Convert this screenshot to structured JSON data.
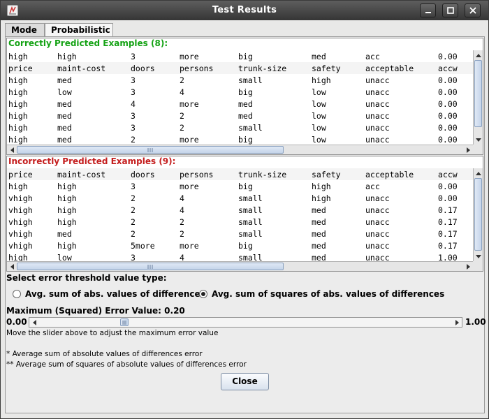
{
  "window": {
    "title": "Test Results"
  },
  "tabs": [
    {
      "label": "Mode"
    },
    {
      "label": "Probabilistic"
    }
  ],
  "columns": [
    "price",
    "maint-cost",
    "doors",
    "persons",
    "trunk-size",
    "safety",
    "acceptable",
    "accw"
  ],
  "correct": {
    "caption": "Correctly Predicted Examples (8):",
    "rows": [
      [
        "high",
        "high",
        "3",
        "more",
        "big",
        "med",
        "acc",
        "0.00"
      ],
      [
        "high",
        "med",
        "3",
        "2",
        "small",
        "high",
        "unacc",
        "0.00"
      ],
      [
        "high",
        "low",
        "3",
        "4",
        "big",
        "low",
        "unacc",
        "0.00"
      ],
      [
        "high",
        "med",
        "4",
        "more",
        "med",
        "low",
        "unacc",
        "0.00"
      ],
      [
        "high",
        "med",
        "3",
        "2",
        "med",
        "low",
        "unacc",
        "0.00"
      ],
      [
        "high",
        "med",
        "3",
        "2",
        "small",
        "low",
        "unacc",
        "0.00"
      ],
      [
        "high",
        "med",
        "2",
        "more",
        "big",
        "low",
        "unacc",
        "0.00"
      ]
    ]
  },
  "incorrect": {
    "caption": "Incorrectly Predicted Examples (9):",
    "rows": [
      [
        "high",
        "high",
        "3",
        "more",
        "big",
        "high",
        "acc",
        "0.00"
      ],
      [
        "vhigh",
        "high",
        "2",
        "4",
        "small",
        "high",
        "unacc",
        "0.00"
      ],
      [
        "vhigh",
        "high",
        "2",
        "4",
        "small",
        "med",
        "unacc",
        "0.17"
      ],
      [
        "vhigh",
        "high",
        "2",
        "2",
        "small",
        "med",
        "unacc",
        "0.17"
      ],
      [
        "vhigh",
        "med",
        "2",
        "2",
        "small",
        "med",
        "unacc",
        "0.17"
      ],
      [
        "vhigh",
        "high",
        "5more",
        "more",
        "big",
        "med",
        "unacc",
        "0.17"
      ],
      [
        "high",
        "low",
        "3",
        "4",
        "small",
        "med",
        "unacc",
        "1.00"
      ]
    ]
  },
  "threshold": {
    "prompt": "Select error threshold value type:",
    "options": [
      {
        "label": "Avg. sum of abs. values of differences",
        "selected": false
      },
      {
        "label": "Avg. sum of squares of abs. values of differences",
        "selected": true
      }
    ]
  },
  "slider": {
    "label": "Maximum (Squared) Error Value: 0.20",
    "min_label": "0.00",
    "max_label": "1.00",
    "value": 0.2,
    "hint": "Move the slider above to adjust the maximum error value"
  },
  "footnotes": [
    "* Average sum of absolute values of differences error",
    "** Average sum of squares of absolute values of differences error"
  ],
  "close_label": "Close"
}
